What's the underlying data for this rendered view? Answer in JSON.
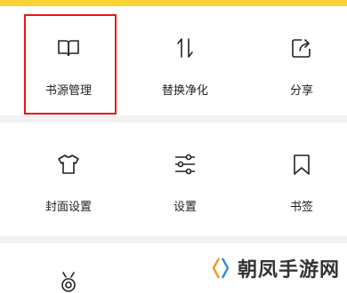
{
  "menu": {
    "row1": [
      {
        "label": "书源管理",
        "icon": "book-open-icon"
      },
      {
        "label": "替换净化",
        "icon": "swap-arrows-icon"
      },
      {
        "label": "分享",
        "icon": "share-icon"
      }
    ],
    "row2": [
      {
        "label": "封面设置",
        "icon": "shirt-icon"
      },
      {
        "label": "设置",
        "icon": "sliders-icon"
      },
      {
        "label": "书签",
        "icon": "bookmark-icon"
      }
    ]
  },
  "watermark": {
    "text": "朝凤手游网"
  },
  "colors": {
    "accent": "#fbd233",
    "highlight": "#e8141b",
    "divider": "#f2f2f2"
  }
}
